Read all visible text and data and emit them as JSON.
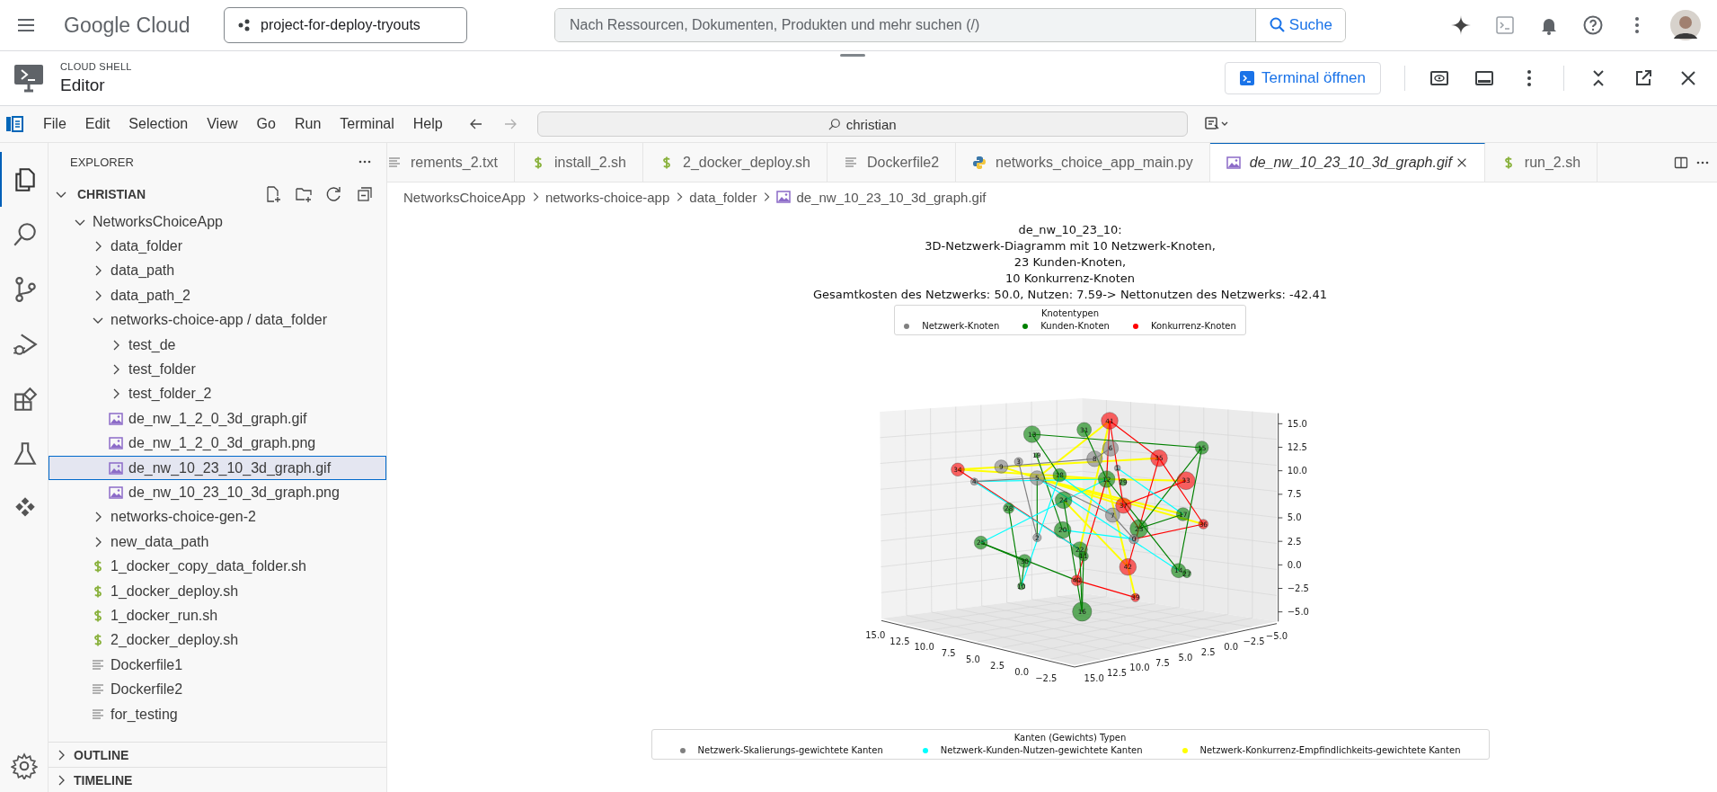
{
  "topbar": {
    "logo": "Google Cloud",
    "project": "project-for-deploy-tryouts",
    "search": {
      "placeholder": "Nach Ressourcen, Dokumenten, Produkten und mehr suchen (/)"
    },
    "search_button": "Suche"
  },
  "cloud_shell": {
    "eyebrow": "CLOUD SHELL",
    "title": "Editor",
    "terminal_button": "Terminal öffnen"
  },
  "menu": [
    "File",
    "Edit",
    "Selection",
    "View",
    "Go",
    "Run",
    "Terminal",
    "Help"
  ],
  "command_center": "christian",
  "activity_bar": [
    {
      "kind": "files",
      "selected": true
    },
    {
      "kind": "search",
      "selected": false
    },
    {
      "kind": "scm",
      "selected": false
    },
    {
      "kind": "debug",
      "selected": false
    },
    {
      "kind": "extensions",
      "selected": false
    },
    {
      "kind": "testing",
      "selected": false
    },
    {
      "kind": "cloudcode",
      "selected": false
    }
  ],
  "explorer": {
    "title": "EXPLORER",
    "root": {
      "label": "CHRISTIAN",
      "expanded": true
    },
    "tree": [
      {
        "label": "NetworksChoiceApp",
        "kind": "folder",
        "expanded": true,
        "selected": false,
        "children": [
          {
            "label": "data_folder",
            "kind": "folder",
            "expanded": false,
            "selected": false
          },
          {
            "label": "data_path",
            "kind": "folder",
            "expanded": false,
            "selected": false
          },
          {
            "label": "data_path_2",
            "kind": "folder",
            "expanded": false,
            "selected": false
          },
          {
            "label": "networks-choice-app / data_folder",
            "kind": "folder",
            "expanded": true,
            "selected": false,
            "children": [
              {
                "label": "test_de",
                "kind": "folder",
                "expanded": false,
                "selected": false
              },
              {
                "label": "test_folder",
                "kind": "folder",
                "expanded": false,
                "selected": false
              },
              {
                "label": "test_folder_2",
                "kind": "folder",
                "expanded": false,
                "selected": false
              },
              {
                "label": "de_nw_1_2_0_3d_graph.gif",
                "kind": "image",
                "selected": false
              },
              {
                "label": "de_nw_1_2_0_3d_graph.png",
                "kind": "image",
                "selected": false
              },
              {
                "label": "de_nw_10_23_10_3d_graph.gif",
                "kind": "image",
                "selected": true
              },
              {
                "label": "de_nw_10_23_10_3d_graph.png",
                "kind": "image",
                "selected": false
              }
            ]
          },
          {
            "label": "networks-choice-gen-2",
            "kind": "folder",
            "expanded": false,
            "selected": false
          },
          {
            "label": "new_data_path",
            "kind": "folder",
            "expanded": false,
            "selected": false
          },
          {
            "label": "1_docker_copy_data_folder.sh",
            "kind": "shell",
            "selected": false
          },
          {
            "label": "1_docker_deploy.sh",
            "kind": "shell",
            "selected": false
          },
          {
            "label": "1_docker_run.sh",
            "kind": "shell",
            "selected": false
          },
          {
            "label": "2_docker_deploy.sh",
            "kind": "shell",
            "selected": false
          },
          {
            "label": "Dockerfile1",
            "kind": "text",
            "selected": false
          },
          {
            "label": "Dockerfile2",
            "kind": "text",
            "selected": false
          },
          {
            "label": "for_testing",
            "kind": "text",
            "selected": false
          }
        ]
      }
    ],
    "sections": [
      {
        "label": "OUTLINE",
        "expanded": false
      },
      {
        "label": "TIMELINE",
        "expanded": false
      }
    ]
  },
  "tabs": [
    {
      "label": "rements_2.txt",
      "kind": "text",
      "selected": false
    },
    {
      "label": "install_2.sh",
      "kind": "shell",
      "selected": false
    },
    {
      "label": "2_docker_deploy.sh",
      "kind": "shell",
      "selected": false
    },
    {
      "label": "Dockerfile2",
      "kind": "text",
      "selected": false
    },
    {
      "label": "networks_choice_app_main.py",
      "kind": "python",
      "selected": false
    },
    {
      "label": "de_nw_10_23_10_3d_graph.gif",
      "kind": "image",
      "selected": true
    },
    {
      "label": "run_2.sh",
      "kind": "shell",
      "selected": false
    }
  ],
  "breadcrumb": [
    "NetworksChoiceApp",
    "networks-choice-app",
    "data_folder",
    "de_nw_10_23_10_3d_graph.gif"
  ],
  "graph": {
    "title": [
      "de_nw_10_23_10:",
      "3D-Netzwerk-Diagramm mit 10 Netzwerk-Knoten,",
      "23 Kunden-Knoten,",
      "10 Konkurrenz-Knoten",
      "Gesamtkosten des Netzwerks: 50.0, Nutzen: 7.59-> Nettonutzen des Netzwerks: -42.41"
    ],
    "node_legend": {
      "title": "Knotentypen",
      "items": [
        {
          "kind": "network",
          "label": "Netzwerk-Knoten",
          "color": "#808080"
        },
        {
          "kind": "customer",
          "label": "Kunden-Knoten",
          "color": "#008000"
        },
        {
          "kind": "competitor",
          "label": "Konkurrenz-Knoten",
          "color": "#ff0000"
        }
      ]
    },
    "edge_legend": {
      "title": "Kanten (Gewichts) Typen",
      "items": [
        {
          "label": "Netzwerk-Skalierungs-gewichtete Kanten",
          "color": "#808080"
        },
        {
          "label": "Netzwerk-Kunden-Nutzen-gewichtete Kanten",
          "color": "#00ffff"
        },
        {
          "label": "Netzwerk-Konkurrenz-Empfindlichkeits-gewichtete Kanten",
          "color": "#ffff00"
        }
      ]
    },
    "nodes": [
      {
        "label": "41",
        "kind": "competitor"
      },
      {
        "label": "31",
        "kind": "customer"
      },
      {
        "label": "13",
        "kind": "customer"
      },
      {
        "label": "6",
        "kind": "network"
      },
      {
        "label": "15",
        "kind": "customer"
      },
      {
        "label": "8",
        "kind": "network"
      },
      {
        "label": "35",
        "kind": "competitor"
      },
      {
        "label": "19",
        "kind": "customer"
      },
      {
        "label": "3",
        "kind": "network"
      },
      {
        "label": "9",
        "kind": "network"
      },
      {
        "label": "34",
        "kind": "competitor"
      },
      {
        "label": "1",
        "kind": "network"
      },
      {
        "label": "5",
        "kind": "network"
      },
      {
        "label": "18",
        "kind": "customer"
      },
      {
        "label": "4",
        "kind": "network"
      },
      {
        "label": "12",
        "kind": "customer"
      },
      {
        "label": "29",
        "kind": "customer"
      },
      {
        "label": "33",
        "kind": "competitor"
      },
      {
        "label": "24",
        "kind": "customer"
      },
      {
        "label": "28",
        "kind": "customer"
      },
      {
        "label": "37",
        "kind": "competitor"
      },
      {
        "label": "7",
        "kind": "network"
      },
      {
        "label": "17",
        "kind": "customer"
      },
      {
        "label": "36",
        "kind": "competitor"
      },
      {
        "label": "20",
        "kind": "customer"
      },
      {
        "label": "23",
        "kind": "customer"
      },
      {
        "label": "25",
        "kind": "customer"
      },
      {
        "label": "2",
        "kind": "network"
      },
      {
        "label": "0",
        "kind": "network"
      },
      {
        "label": "22",
        "kind": "customer"
      },
      {
        "label": "11",
        "kind": "customer"
      },
      {
        "label": "30",
        "kind": "customer"
      },
      {
        "label": "42",
        "kind": "competitor"
      },
      {
        "label": "14",
        "kind": "customer"
      },
      {
        "label": "27",
        "kind": "customer"
      },
      {
        "label": "10",
        "kind": "customer"
      },
      {
        "label": "40",
        "kind": "competitor"
      },
      {
        "label": "39",
        "kind": "competitor"
      },
      {
        "label": "16",
        "kind": "customer"
      }
    ],
    "x_ticks": [
      "15.0",
      "12.5",
      "10.0",
      "7.5",
      "5.0",
      "2.5",
      "0.0",
      "−2.5"
    ],
    "y_ticks": [
      "15.0",
      "12.5",
      "10.0",
      "7.5",
      "5.0",
      "2.5",
      "0.0",
      "−2.5",
      "−5.0"
    ],
    "z_ticks": [
      "15.0",
      "12.5",
      "10.0",
      "7.5",
      "5.0",
      "2.5",
      "0.0",
      "−2.5",
      "−5.0"
    ]
  }
}
